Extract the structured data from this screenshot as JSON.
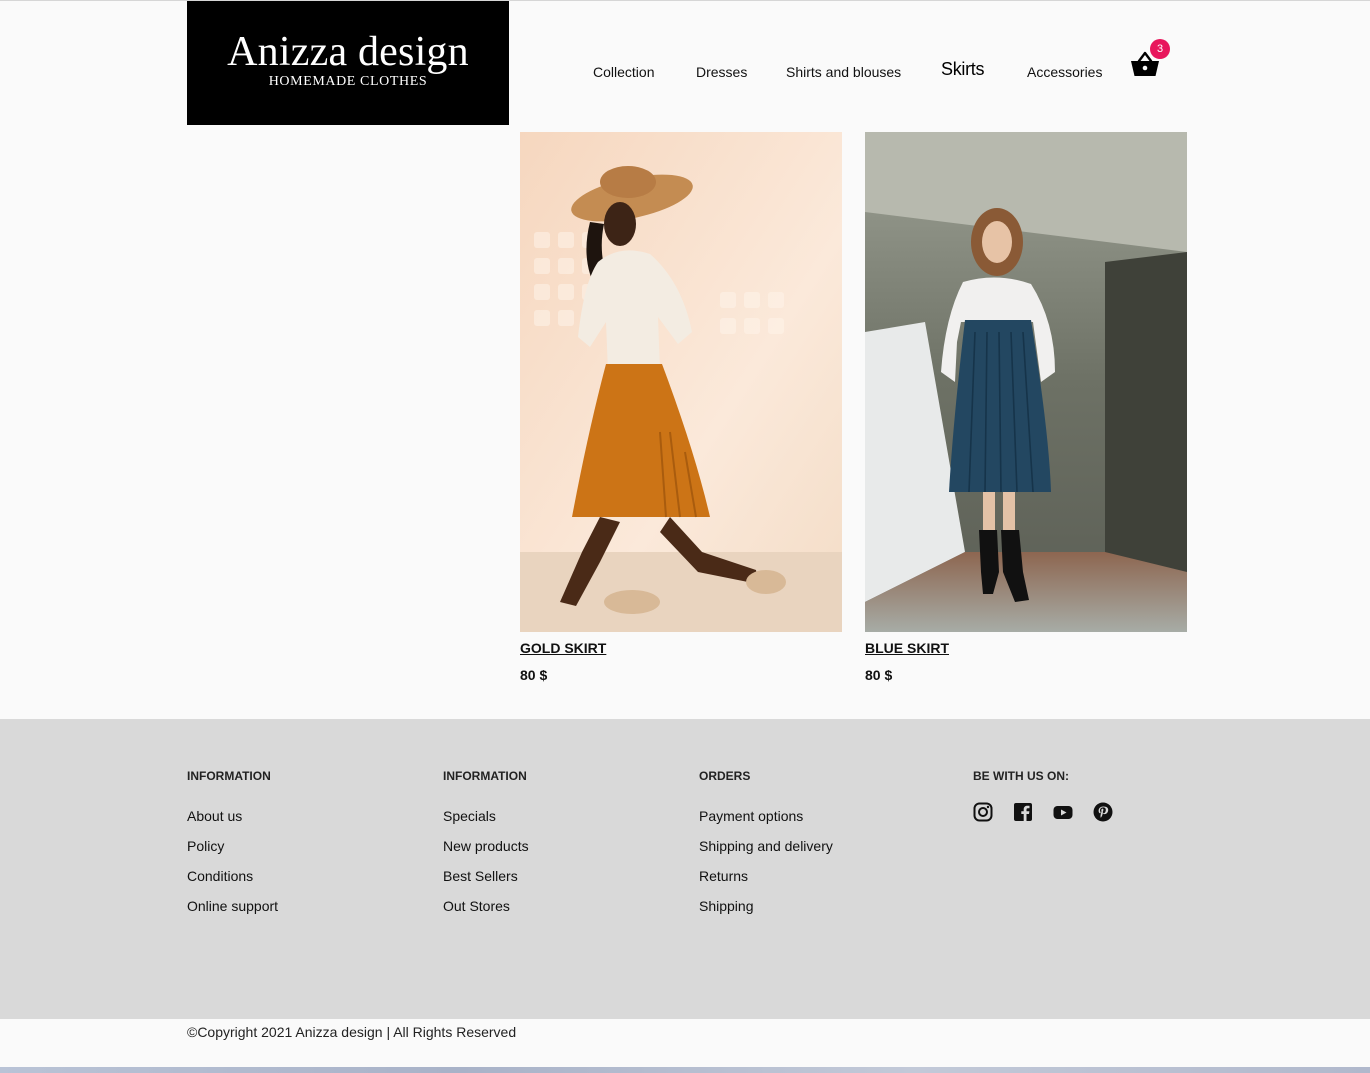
{
  "brand": {
    "title": "Anizza design",
    "subtitle": "HOMEMADE CLOTHES"
  },
  "nav": {
    "items": [
      {
        "label": "Collection"
      },
      {
        "label": "Dresses"
      },
      {
        "label": "Shirts and blouses"
      },
      {
        "label": "Skirts",
        "active": true
      },
      {
        "label": "Accessories"
      }
    ]
  },
  "cart": {
    "count": "3",
    "icon": "basket-icon",
    "badge_color": "#e8165c"
  },
  "products": [
    {
      "name": "GOLD SKIRT",
      "price": "80 $"
    },
    {
      "name": "BLUE SKIRT",
      "price": "80 $"
    }
  ],
  "footer": {
    "columns": [
      {
        "heading": "INFORMATION",
        "links": [
          "About us",
          "Policy",
          "Conditions",
          "Online support"
        ]
      },
      {
        "heading": "INFORMATION",
        "links": [
          "Specials",
          "New products",
          "Best Sellers",
          "Out Stores"
        ]
      },
      {
        "heading": "ORDERS",
        "links": [
          "Payment options",
          "Shipping and delivery",
          "Returns",
          "Shipping"
        ]
      }
    ],
    "social_heading": "BE WITH US ON:",
    "social_icons": [
      "instagram-icon",
      "facebook-icon",
      "youtube-icon",
      "pinterest-icon"
    ]
  },
  "copyright": "©Copyright 2021 Anizza design | All Rights Reserved"
}
